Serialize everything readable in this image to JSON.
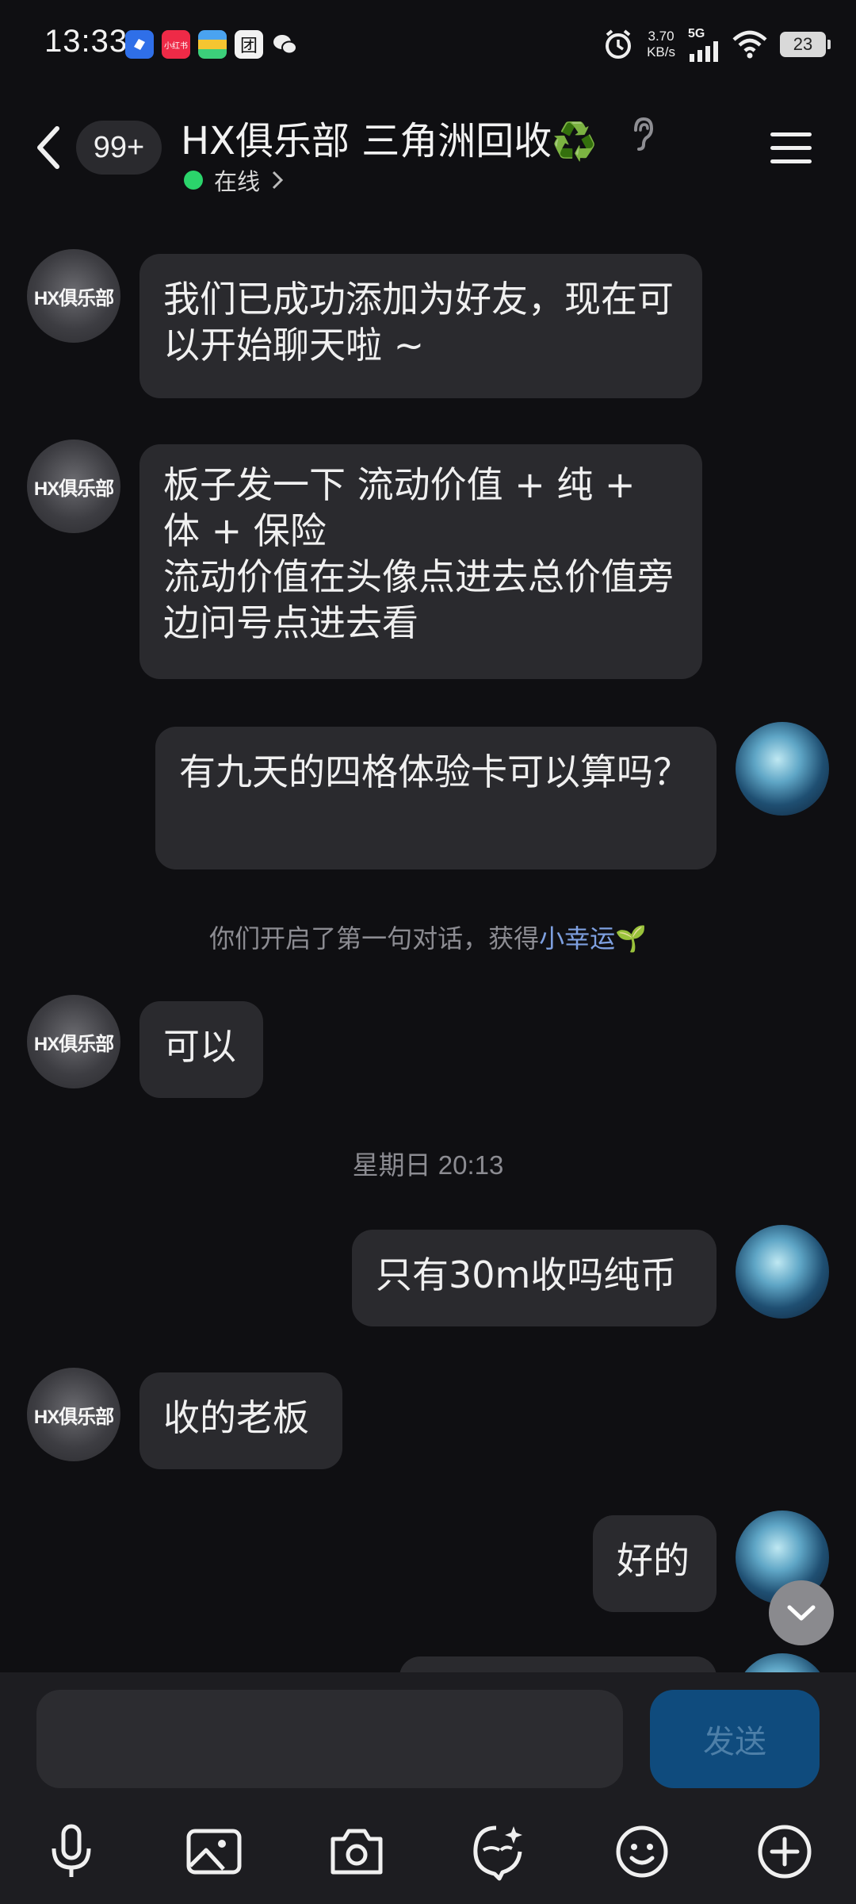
{
  "status_bar": {
    "time": "13:33",
    "app_icons": [
      "blue-app-icon",
      "xiaohongshu-icon",
      "wallet-icon",
      "tuan-icon",
      "wechat-icon"
    ],
    "app_icon_labels": {
      "xiaohongshu": "小红书",
      "tuan": "团"
    },
    "net_speed_value": "3.70",
    "net_speed_unit": "KB/s",
    "network": "5G",
    "battery": "23"
  },
  "header": {
    "unread_count": "99+",
    "title": "HX俱乐部 三角洲回收",
    "title_emoji": "♻️",
    "status": "在线"
  },
  "messages": [
    {
      "side": "left",
      "text": "我们已成功添加为好友，现在可以开始聊天啦 ~"
    },
    {
      "side": "left",
      "text": "板子发一下  流动价值  + 纯 + 体 + 保险\n流动价值在头像点进去总价值旁边问号点进去看"
    },
    {
      "side": "right",
      "text": "有九天的四格体验卡可以算吗？"
    },
    {
      "side": "system",
      "text": "你们开启了第一句对话，获得",
      "link": "小幸运"
    },
    {
      "side": "left",
      "text": "可以"
    },
    {
      "side": "time",
      "text": "星期日 20:13"
    },
    {
      "side": "right",
      "text": "只有30m收吗纯币"
    },
    {
      "side": "left",
      "text": "收的老板"
    },
    {
      "side": "right",
      "text": "好的"
    }
  ],
  "avatar_text": "HX俱乐部",
  "input": {
    "placeholder": "",
    "send_label": "发送"
  },
  "toolbar": [
    "microphone-icon",
    "image-icon",
    "camera-icon",
    "emoji-creator-icon",
    "smiley-icon",
    "plus-icon"
  ],
  "colors": {
    "background": "#0f0f12",
    "bubble": "#2a2a2e",
    "online": "#2bd46b",
    "send_button": "#0f4b7d",
    "link": "#7ea0e0"
  }
}
